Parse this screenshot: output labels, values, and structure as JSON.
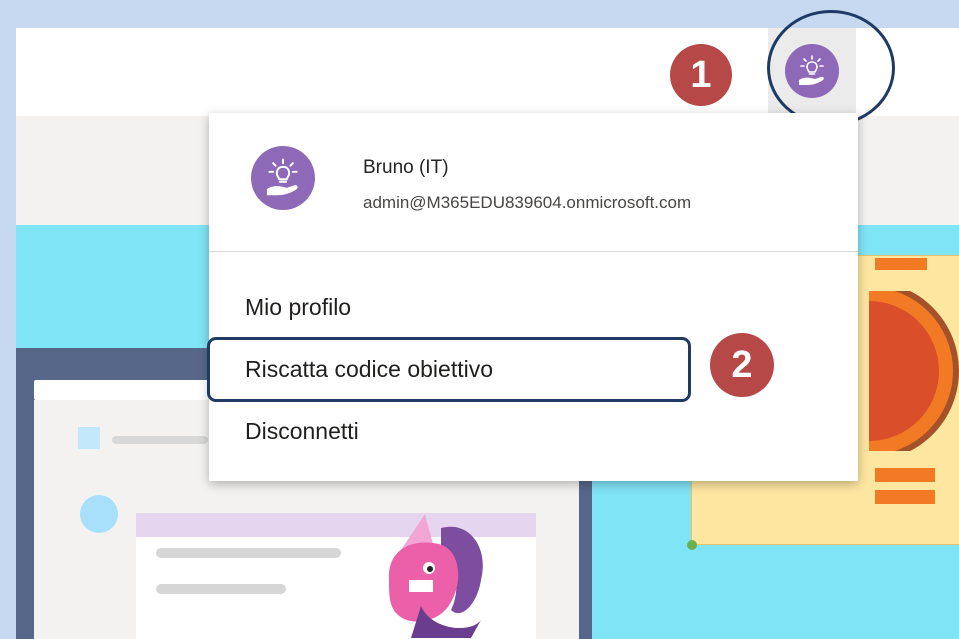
{
  "account": {
    "name": "Bruno (IT)",
    "email": "admin@M365EDU839604.onmicrosoft.com",
    "avatar_icon": "lightbulb-hand-icon",
    "avatar_color": "#8e69b8"
  },
  "menu": {
    "items": [
      {
        "label": "Mio profilo"
      },
      {
        "label": "Riscatta codice obiettivo"
      },
      {
        "label": "Disconnetti"
      }
    ]
  },
  "callouts": {
    "step1": "1",
    "step2": "2",
    "badge_color": "#b64848",
    "outline_color": "#1f3b64"
  }
}
